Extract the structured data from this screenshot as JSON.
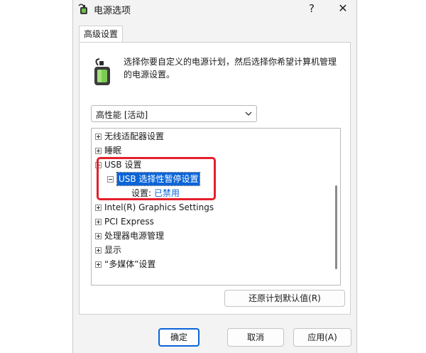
{
  "window": {
    "title": "电源选项",
    "help_label": "?",
    "close_label": "✕"
  },
  "tab": {
    "label": "高级设置"
  },
  "description": "选择你要自定义的电源计划，然后选择你希望计算机管理的电源设置。",
  "plan_select": {
    "value": "高性能 [活动]"
  },
  "tree": {
    "items": [
      {
        "label": "无线适配器设置"
      },
      {
        "label": "睡眠"
      },
      {
        "label": "USB 设置"
      },
      {
        "label": "USB 选择性暂停设置"
      },
      {
        "label": "Intel(R) Graphics Settings"
      },
      {
        "label": "PCI Express"
      },
      {
        "label": "处理器电源管理"
      },
      {
        "label": "显示"
      },
      {
        "label": "“多媒体”设置"
      }
    ],
    "setting": {
      "label": "设置:",
      "value": "已禁用"
    }
  },
  "buttons": {
    "restore": "还原计划默认值(R)",
    "ok": "确定",
    "cancel": "取消",
    "apply": "应用(A)"
  },
  "colors": {
    "accent": "#0a64d8",
    "highlight_box": "#e3202c",
    "selected_bg": "#0a64d8"
  },
  "icons": {
    "title_icon": "power-battery-icon",
    "description_icon": "power-battery-icon",
    "select_arrow": "chevron-down-icon"
  }
}
